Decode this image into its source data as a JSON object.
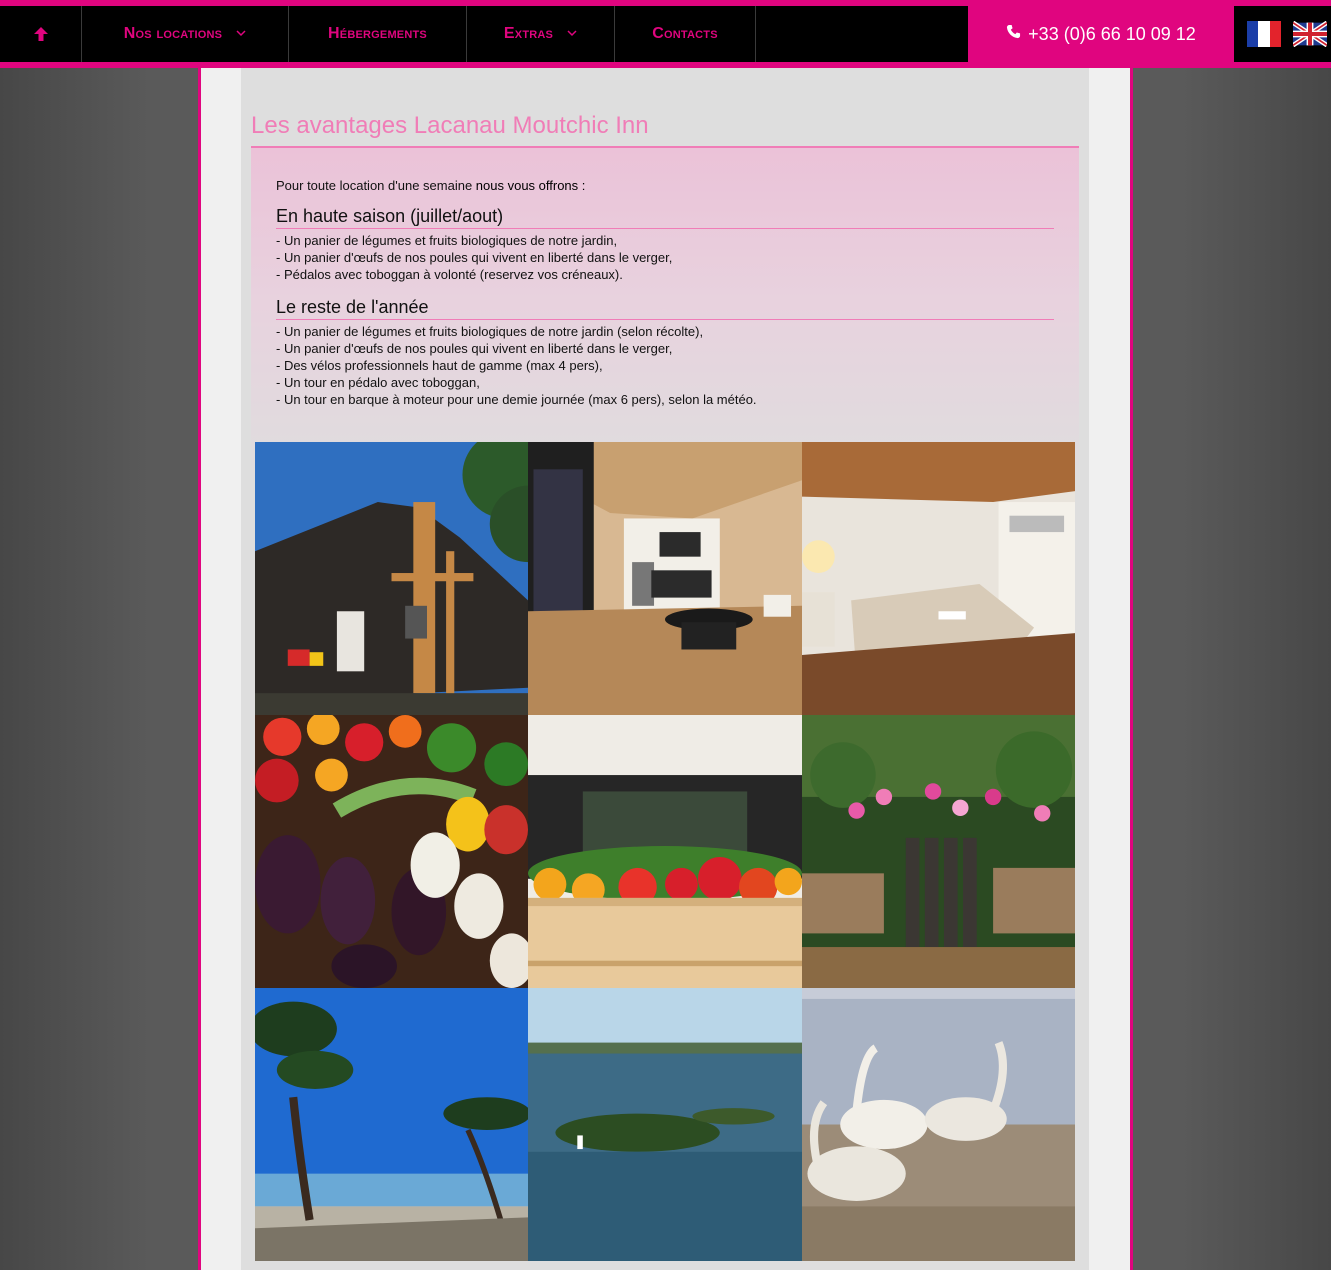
{
  "nav": {
    "items": [
      {
        "label": "Nos locations",
        "has_dropdown": true
      },
      {
        "label": "Hébergements",
        "has_dropdown": false
      },
      {
        "label": "Extras",
        "has_dropdown": true
      },
      {
        "label": "Contacts",
        "has_dropdown": false
      }
    ],
    "phone": "+33 (0)6 66 10 09 12",
    "languages": [
      "fr-flag-icon",
      "uk-flag-icon"
    ]
  },
  "main": {
    "title": "Les avantages Lacanau Moutchic Inn",
    "intro_prefix": "Pour toute location d'une semaine ",
    "intro_bold": "nous vous offrons :",
    "high_season": {
      "heading": "En haute saison (juillet/aout)",
      "items": [
        "- Un panier de légumes et fruits biologiques de notre jardin,",
        "- Un panier d'œufs de nos poules qui vivent en liberté dans le verger,",
        "- Pédalos avec toboggan à volonté (reservez vos créneaux)."
      ]
    },
    "rest_of_year": {
      "heading": "Le reste de l'année",
      "items": [
        "- Un panier de légumes et fruits biologiques de notre jardin (selon récolte),",
        "- Un panier d'œufs de nos poules qui vivent en liberté dans le verger,",
        "- Des vélos professionnels haut de gamme (max 4 pers),",
        "- Un tour en pédalo avec toboggan,",
        "- Un tour en barque à moteur pour une demie journée (max 6 pers), selon la météo."
      ]
    }
  },
  "colors": {
    "brand": "#e0057f",
    "title": "#f07db7",
    "navbar": "#000000"
  }
}
